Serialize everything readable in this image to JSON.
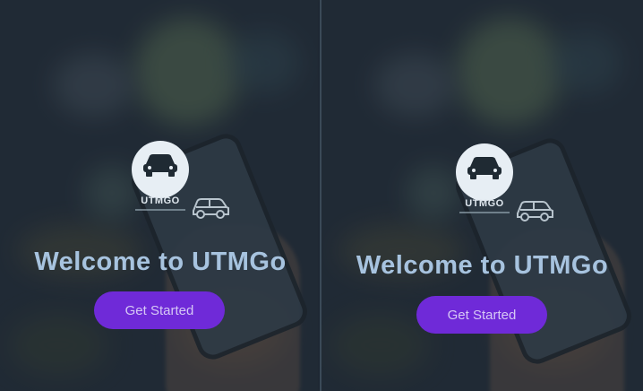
{
  "screens": [
    {
      "brand_name": "UTMGO",
      "title": "Welcome to UTMGo",
      "cta_label": "Get Started",
      "logo_icon": "car-icon",
      "secondary_icon": "car-outline-icon"
    },
    {
      "brand_name": "UTMGO",
      "title": "Welcome to UTMGo",
      "cta_label": "Get Started",
      "logo_icon": "car-icon",
      "secondary_icon": "car-outline-icon"
    }
  ],
  "colors": {
    "button": "#6f2ad8",
    "title": "#a7c3df",
    "background": "#26323e"
  }
}
